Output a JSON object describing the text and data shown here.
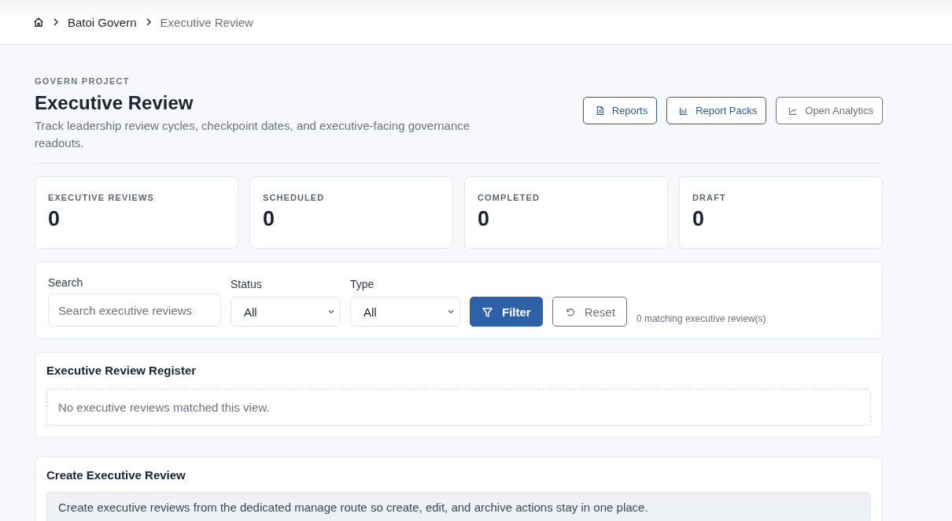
{
  "breadcrumb": {
    "items": [
      {
        "label": "Batoi Govern",
        "current": false
      },
      {
        "label": "Executive Review",
        "current": true
      }
    ]
  },
  "header": {
    "eyebrow": "GOVERN PROJECT",
    "title": "Executive Review",
    "description": "Track leadership review cycles, checkpoint dates, and executive-facing governance readouts.",
    "actions": [
      {
        "label": "Reports"
      },
      {
        "label": "Report Packs"
      },
      {
        "label": "Open Analytics"
      }
    ]
  },
  "stats": [
    {
      "label": "EXECUTIVE REVIEWS",
      "value": "0"
    },
    {
      "label": "SCHEDULED",
      "value": "0"
    },
    {
      "label": "COMPLETED",
      "value": "0"
    },
    {
      "label": "DRAFT",
      "value": "0"
    }
  ],
  "filters": {
    "search": {
      "label": "Search",
      "placeholder": "Search executive reviews"
    },
    "selects": [
      {
        "label": "Status",
        "value": "All"
      },
      {
        "label": "Type",
        "value": "All"
      }
    ],
    "buttons": [
      {
        "label": "Filter"
      },
      {
        "label": "Reset"
      }
    ],
    "count": "0 matching executive review(s)"
  },
  "register": {
    "title": "Executive Review Register",
    "empty": "No executive reviews matched this view."
  },
  "create": {
    "title": "Create Executive Review",
    "note": "Create executive reviews from the dedicated manage route so create, edit, and archive actions stay in one place."
  }
}
